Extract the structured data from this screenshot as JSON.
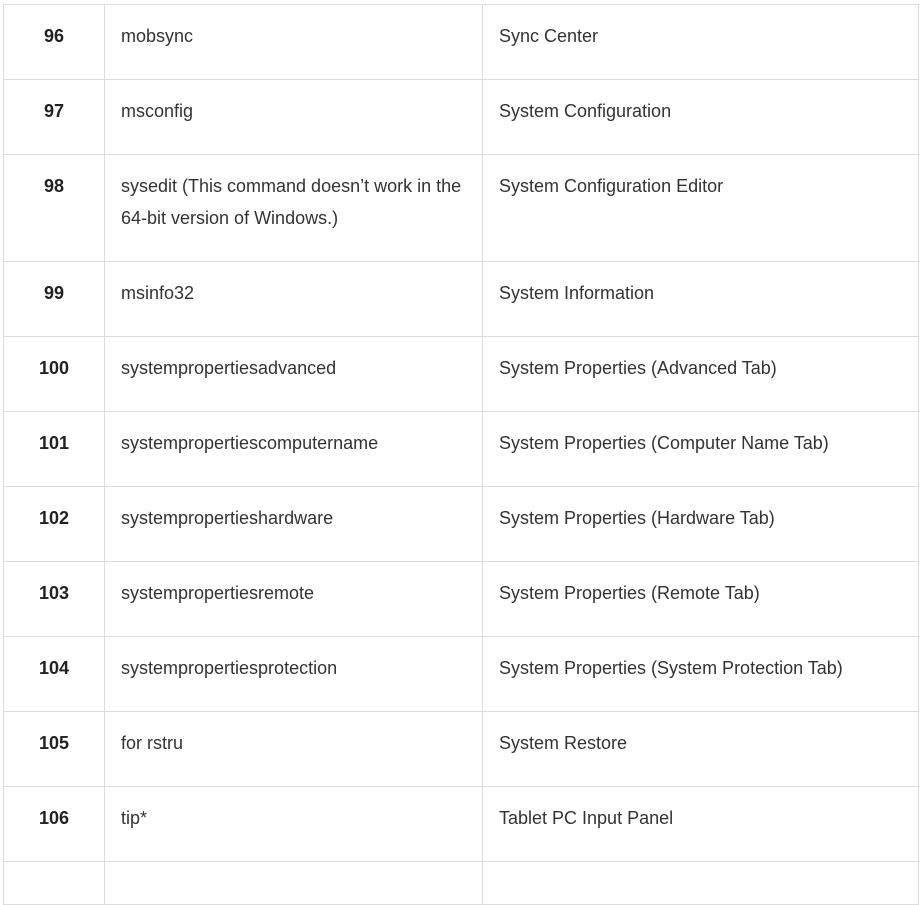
{
  "rows": [
    {
      "num": "96",
      "command": "mobsync",
      "description": "Sync Center"
    },
    {
      "num": "97",
      "command": "msconfig",
      "description": "System Configuration"
    },
    {
      "num": "98",
      "command": "sysedit (This command doesn’t work in the 64-bit version of Windows.)",
      "description": "System Configuration Editor"
    },
    {
      "num": "99",
      "command": "msinfo32",
      "description": "System Information"
    },
    {
      "num": "100",
      "command": "systempropertiesadvanced",
      "description": "System Properties (Advanced Tab)"
    },
    {
      "num": "101",
      "command": "systempropertiescomputername",
      "description": "System Properties (Computer Name Tab)"
    },
    {
      "num": "102",
      "command": "systempropertieshardware",
      "description": "System Properties (Hardware Tab)"
    },
    {
      "num": "103",
      "command": "systempropertiesremote",
      "description": "System Properties (Remote Tab)"
    },
    {
      "num": "104",
      "command": "systempropertiesprotection",
      "description": "System Properties (System Protection Tab)"
    },
    {
      "num": "105",
      "command": "for rstru",
      "description": "System Restore"
    },
    {
      "num": "106",
      "command": "tip*",
      "description": "Tablet PC Input Panel"
    },
    {
      "num": "",
      "command": "",
      "description": ""
    }
  ]
}
